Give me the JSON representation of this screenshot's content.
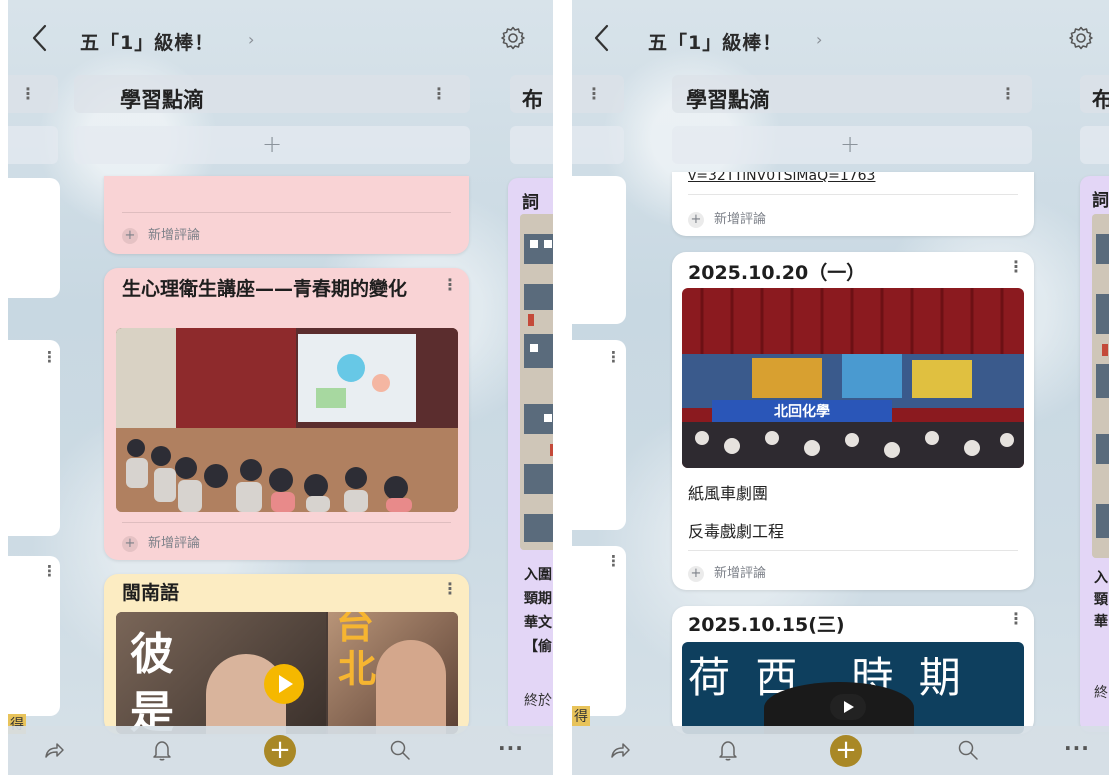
{
  "board": {
    "title": "五「1」級棒！",
    "chevron": "›"
  },
  "column": {
    "title": "學習點滴",
    "add_symbol": "+"
  },
  "next_column": {
    "title_left": "布",
    "title_right": "布"
  },
  "left": {
    "cards": [
      {
        "title": "生心理衛生講座——青春期的變化",
        "color": "pink"
      },
      {
        "title": "閩南語",
        "color": "yellow",
        "image_text_1": "彼",
        "image_text_2": "是",
        "image_text_3": "台",
        "image_text_4": "北"
      }
    ],
    "comment_label": "新增評論",
    "next_column_card": {
      "title": "詞",
      "lines": [
        "入圍",
        "頸期",
        "華文",
        "【偷"
      ],
      "footer": "終於"
    }
  },
  "right": {
    "link_fragment": "v=32TTiNV0TSiMaQ=1763",
    "cards": [
      {
        "title": "2025.10.20（一）",
        "lines": [
          "紙風車劇團",
          "反毒戲劇工程"
        ],
        "banner": "北回化學"
      },
      {
        "title": "2025.10.15(三)",
        "image_text": "荷 西　時 期"
      }
    ],
    "comment_label": "新增評論",
    "next_column_card": {
      "title": "詞",
      "lines": [
        "入",
        "頸",
        "華"
      ],
      "footer": "終"
    }
  },
  "side_label": "得",
  "bottom_nav": {
    "add_symbol": "+",
    "more": "···"
  }
}
